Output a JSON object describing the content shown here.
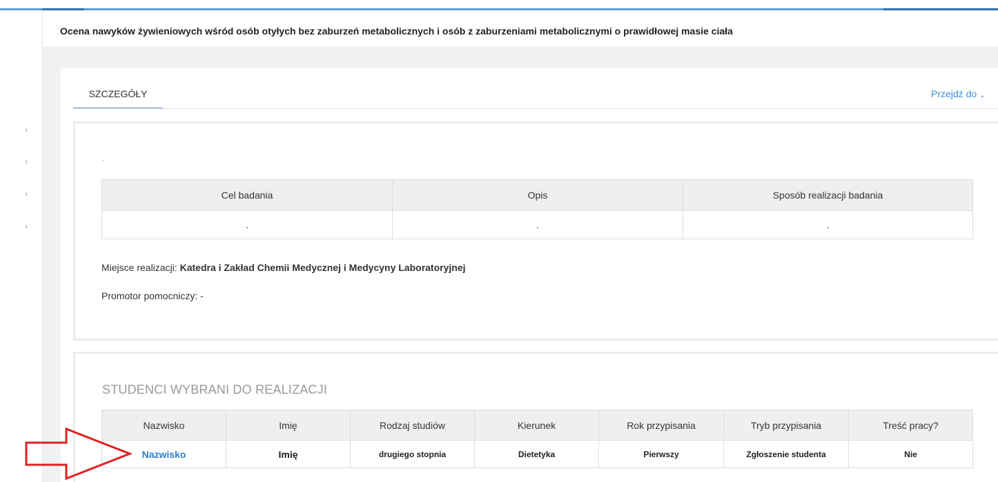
{
  "page": {
    "title": "Ocena nawyków żywieniowych wśród osób otyłych bez zaburzeń metabolicznych i osób z zaburzeniami metabolicznymi o prawidłowej masie ciała"
  },
  "tabs": [
    {
      "label": "SZCZEGÓŁY",
      "active": true
    }
  ],
  "goto": {
    "label": "Przejdź do"
  },
  "sidebar": {
    "chevron": "›"
  },
  "details": {
    "dot": ".",
    "table": {
      "headers": [
        "Cel badania",
        "Opis",
        "Sposób realizacji badania"
      ],
      "row": [
        ".",
        ".",
        "."
      ]
    },
    "place_label": "Miejsce realizacji:",
    "place_value": "Katedra i Zakład Chemii Medycznej i Medycyny Laboratoryjnej",
    "promotor_label": "Promotor pomocniczy:",
    "promotor_value": "-"
  },
  "students": {
    "title": "STUDENCI WYBRANI DO REALIZACJI",
    "headers": [
      "Nazwisko",
      "Imię",
      "Rodzaj studiów",
      "Kierunek",
      "Rok przypisania",
      "Tryb przypisania",
      "Treść pracy?"
    ],
    "row": {
      "surname": "Nazwisko",
      "first_name": "Imię",
      "study_type": "drugiego stopnia",
      "field": "Dietetyka",
      "year": "Pierwszy",
      "mode": "Zgłoszenie studenta",
      "content": "Nie"
    }
  },
  "colors": {
    "accent": "#3a8ed8",
    "annotation_arrow": "#e02020"
  },
  "icons": [
    "chevron-right-icon",
    "chevron-down-icon",
    "arrow-right-annotation-icon"
  ]
}
